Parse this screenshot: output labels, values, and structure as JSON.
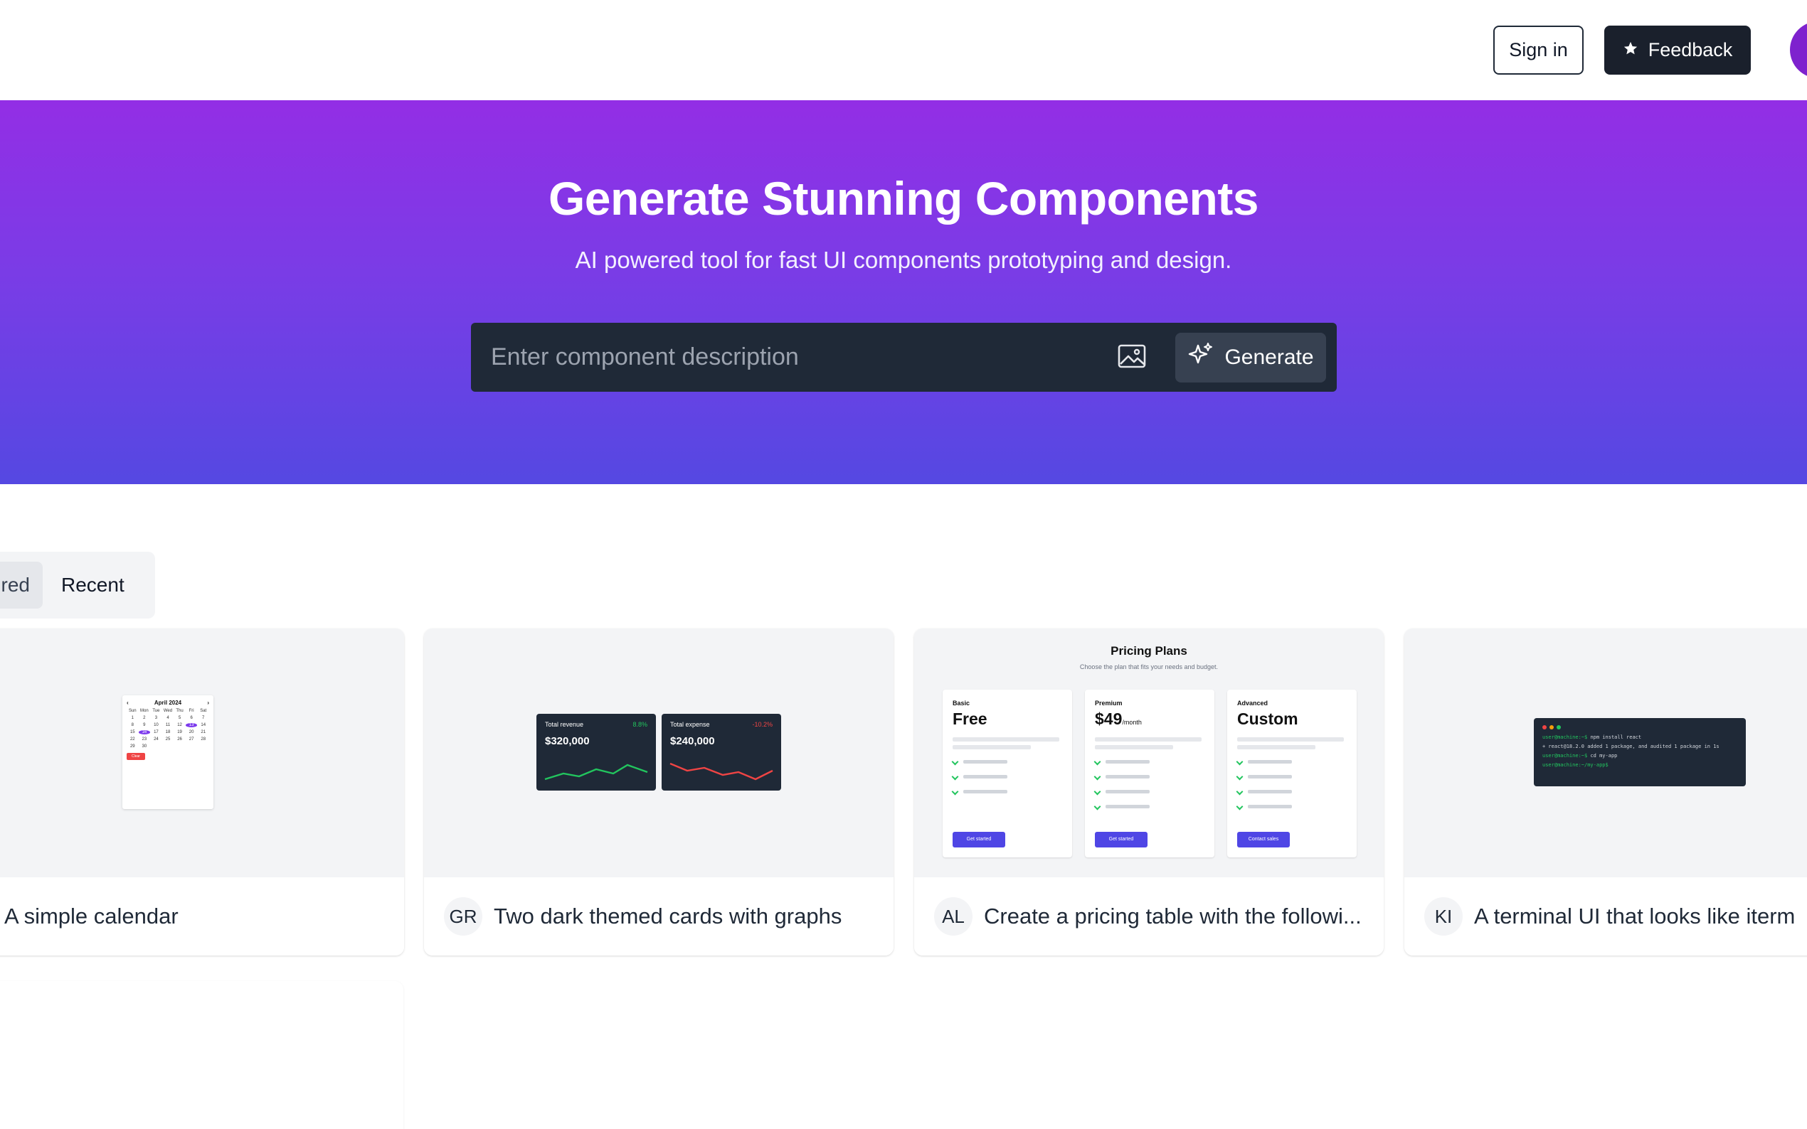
{
  "header": {
    "signin_label": "Sign in",
    "feedback_label": "Feedback",
    "feedback_icon": "star-icon"
  },
  "hero": {
    "title": "Generate Stunning Components",
    "subtitle": "AI powered tool for fast UI components prototyping and design.",
    "input_placeholder": "Enter component description",
    "image_upload_icon": "image-icon",
    "generate_label": "Generate",
    "generate_icon": "sparkles-icon"
  },
  "tabs": [
    {
      "label": "red",
      "active": true
    },
    {
      "label": "Recent",
      "active": false
    }
  ],
  "cards": [
    {
      "initials": "",
      "title": "A simple calendar",
      "preview": {
        "month": "April 2024",
        "weekdays": [
          "Sun",
          "Mon",
          "Tue",
          "Wed",
          "Thu",
          "Fri",
          "Sat"
        ],
        "days": [
          "1",
          "2",
          "3",
          "4",
          "5",
          "6",
          "7",
          "8",
          "9",
          "10",
          "11",
          "12",
          "13",
          "14",
          "15",
          "16",
          "17",
          "18",
          "19",
          "20",
          "21",
          "22",
          "23",
          "24",
          "25",
          "26",
          "27",
          "28",
          "29",
          "30"
        ],
        "clear_label": "Clear"
      }
    },
    {
      "initials": "GR",
      "title": "Two dark themed cards with graphs",
      "preview": {
        "revenue_label": "Total revenue",
        "revenue_change": "8.8%",
        "revenue_value": "$320,000",
        "expense_label": "Total expense",
        "expense_change": "-10.2%",
        "expense_value": "$240,000",
        "positive_color": "#22c55e",
        "negative_color": "#ef4444"
      }
    },
    {
      "initials": "AL",
      "title": "Create a pricing table with the followi...",
      "preview": {
        "heading": "Pricing Plans",
        "subheading": "Choose the plan that fits your needs and budget.",
        "plans": [
          {
            "tier": "Basic",
            "price": "Free",
            "period": "",
            "cta": "Get started"
          },
          {
            "tier": "Premium",
            "price": "$49",
            "period": "/month",
            "cta": "Get started"
          },
          {
            "tier": "Advanced",
            "price": "Custom",
            "period": "",
            "cta": "Contact sales"
          }
        ]
      }
    },
    {
      "initials": "KI",
      "title": "A terminal UI that looks like iterm",
      "preview": {
        "lines": [
          {
            "prompt": "user@machine:~$",
            "cmd": "npm install react"
          },
          {
            "prompt": "",
            "cmd": "+ react@18.2.0 added 1 package, and audited 1 package in 1s"
          },
          {
            "prompt": "user@machine:~$",
            "cmd": "cd my-app"
          },
          {
            "prompt": "user@machine:~/my-app$",
            "cmd": ""
          }
        ]
      }
    }
  ],
  "colors": {
    "hero_top": "#932ee5",
    "hero_bottom": "#5548e2",
    "dark": "#1f2937",
    "accent": "#7c3aed"
  }
}
